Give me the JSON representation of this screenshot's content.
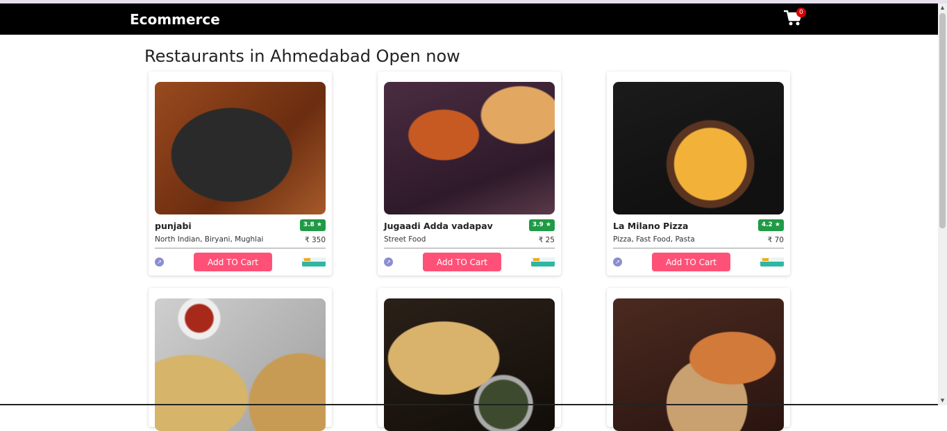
{
  "app": {
    "brand": "Ecommerce",
    "cart_count": "0"
  },
  "page": {
    "heading": "Restaurants in Ahmedabad Open now"
  },
  "common": {
    "add_to_cart_label": "Add TO Cart"
  },
  "restaurants": [
    {
      "name": "punjabi",
      "rating": "3.8 ★",
      "cuisine": "North Indian, Biryani, Mughlai",
      "price": "₹ 350"
    },
    {
      "name": "Jugaadi Adda vadapav",
      "rating": "3.9 ★",
      "cuisine": "Street Food",
      "price": "₹ 25"
    },
    {
      "name": "La Milano Pizza",
      "rating": "4.2 ★",
      "cuisine": "Pizza, Fast Food, Pasta",
      "price": "₹ 70"
    }
  ],
  "colors": {
    "navbar": "#000000",
    "add_button": "#ff5177",
    "rating_badge": "#1f9a45"
  },
  "icons": {
    "cart": "shopping-cart-icon",
    "trend": "trending-icon",
    "safety": "safety-delivery-badge"
  }
}
